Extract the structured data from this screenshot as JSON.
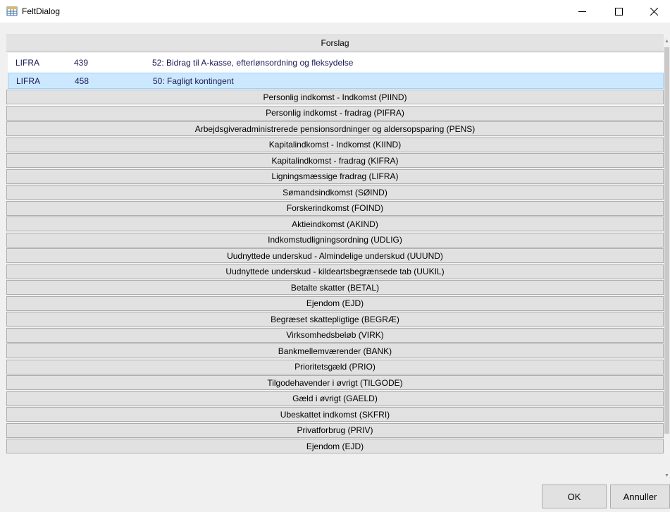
{
  "window": {
    "title": "FeltDialog",
    "minimize_glyph": "—",
    "maximize_glyph": "☐",
    "close_glyph": "✕",
    "icon": "grid-app-icon"
  },
  "suggestions": {
    "header": "Forslag",
    "rows": [
      {
        "code": "LIFRA",
        "number": "439",
        "text": "52: Bidrag til A-kasse, efterlønsordning og fleksydelse",
        "selected": false
      },
      {
        "code": "LIFRA",
        "number": "458",
        "text": "50: Fagligt kontingent",
        "selected": true
      }
    ]
  },
  "groups": [
    "Personlig indkomst - Indkomst (PIIND)",
    "Personlig indkomst - fradrag (PIFRA)",
    "Arbejdsgiveradministrerede pensionsordninger og aldersopsparing (PENS)",
    "Kapitalindkomst - Indkomst (KIIND)",
    "Kapitalindkomst - fradrag (KIFRA)",
    "Ligningsmæssige fradrag (LIFRA)",
    "Sømandsindkomst (SØIND)",
    "Forskerindkomst (FOIND)",
    "Aktieindkomst (AKIND)",
    "Indkomstudligningsordning (UDLIG)",
    "Uudnyttede underskud - Almindelige underskud (UUUND)",
    "Uudnyttede underskud - kildeartsbegrænsede tab (UUKIL)",
    "Betalte skatter (BETAL)",
    "Ejendom (EJD)",
    "Begræset skattepligtige (BEGRÆ)",
    "Virksomhedsbeløb (VIRK)",
    "Bankmellemværender (BANK)",
    "Prioritetsgæld (PRIO)",
    "Tilgodehavender i øvrigt (TILGODE)",
    "Gæld i øvrigt (GAELD)",
    "Ubeskattet indkomst (SKFRI)",
    "Privatforbrug (PRIV)",
    "Ejendom (EJD)"
  ],
  "buttons": {
    "ok": "OK",
    "cancel": "Annuller"
  },
  "colors": {
    "selected_row": "#cce8ff",
    "selected_border": "#99d1ff",
    "group_button": "#e1e1e1"
  }
}
